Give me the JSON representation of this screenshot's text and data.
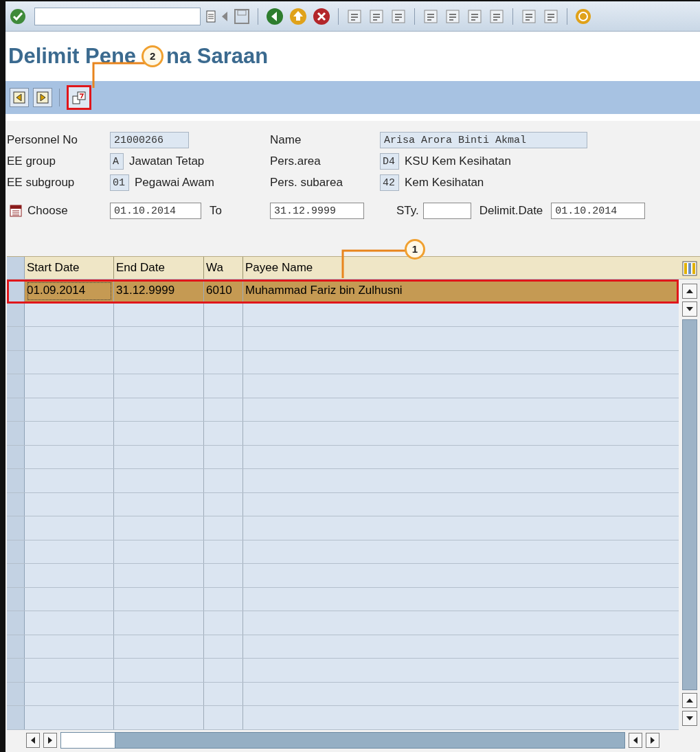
{
  "title_parts": [
    "Delimit Pene",
    "na Saraan"
  ],
  "callouts": [
    {
      "label": "2"
    },
    {
      "label": "1"
    }
  ],
  "app_toolbar": [
    {
      "kind": "previous",
      "highlighted": false
    },
    {
      "kind": "next",
      "highlighted": false
    },
    {
      "kind": "delimit",
      "highlighted": true
    }
  ],
  "form": {
    "personnel_no": {
      "label": "Personnel No",
      "value": "21000266"
    },
    "name": {
      "label": "Name",
      "value": "Arisa Arora Binti Akmal"
    },
    "ee_group": {
      "label": "EE group",
      "code": "A",
      "text": "Jawatan Tetap"
    },
    "pers_area": {
      "label": "Pers.area",
      "code": "D4",
      "text": "KSU Kem Kesihatan"
    },
    "ee_subgroup": {
      "label": "EE subgroup",
      "code": "01",
      "text": "Pegawai Awam"
    },
    "pers_subarea": {
      "label": "Pers. subarea",
      "code": "42",
      "text": "Kem Kesihatan"
    },
    "choose": {
      "label": "Choose",
      "value": "01.10.2014"
    },
    "to": {
      "label": "To",
      "value": "31.12.9999"
    },
    "sty": {
      "label": "STy."
    },
    "delimit_date": {
      "label": "Delimit.Date",
      "value": "01.10.2014"
    }
  },
  "table": {
    "columns": [
      "Start Date",
      "End Date",
      "Wa",
      "Payee Name"
    ],
    "rows": [
      {
        "cells": [
          "01.09.2014",
          "31.12.9999",
          "6010",
          "Muhammad Fariz bin Zulhusni"
        ],
        "selected": true
      }
    ]
  }
}
